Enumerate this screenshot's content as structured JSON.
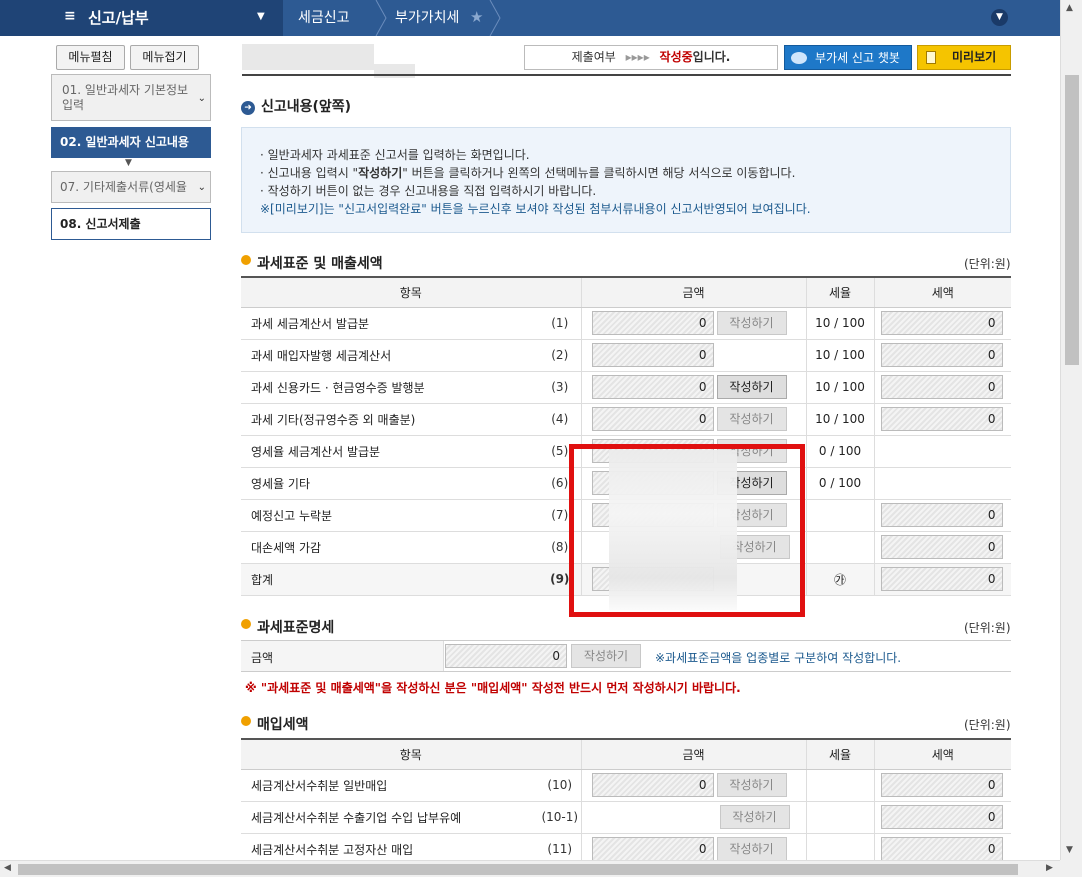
{
  "topnav": {
    "menu_title": "신고/납부",
    "crumb1": "세금신고",
    "crumb2": "부가가치세"
  },
  "sidebar": {
    "expand_label": "메뉴펼침",
    "collapse_label": "메뉴접기",
    "items": [
      {
        "label": "01. 일반과세자 기본정보입력"
      },
      {
        "label": "02. 일반과세자 신고내용"
      },
      {
        "label": "07. 기타제출서류(영세율"
      },
      {
        "label": "08. 신고서제출"
      }
    ]
  },
  "header": {
    "status_prefix": "제출여부",
    "status_arrows": "▸▸▸▸",
    "status_value": "작성중",
    "status_suffix": "입니다.",
    "chatbot_label": "부가세 신고 챗봇",
    "preview_label": "미리보기"
  },
  "section_main": {
    "title": "신고내용(앞쪽)"
  },
  "info": {
    "line1": "일반과세자 과세표준 신고서를 입력하는 화면입니다.",
    "line2_pre": "신고내용 입력시 \"",
    "line2_bold": "작성하기",
    "line2_post": "\" 버튼을 클릭하거나 왼쪽의 선택메뉴를 클릭하시면 해당 서식으로 이동합니다.",
    "line3": "작성하기 버튼이 없는 경우 신고내용을 직접 입력하시기 바랍니다.",
    "note": "※[미리보기]는 \"신고서입력완료\" 버튼을 누르신후 보셔야 작성된 첨부서류내용이 신고서반영되어 보여집니다."
  },
  "section1": {
    "title": "과세표준 및 매출세액",
    "unit": "(단위:원)",
    "headers": [
      "항목",
      "금액",
      "세율",
      "세액"
    ],
    "write_label": "작성하기",
    "rows": [
      {
        "label": "과세 세금계산서 발급분",
        "num": "(1)",
        "amount": "0",
        "rate": "10 / 100",
        "tax": "0"
      },
      {
        "label": "과세 매입자발행 세금계산서",
        "num": "(2)",
        "amount": "0",
        "rate": "10 / 100",
        "tax": "0"
      },
      {
        "label": "과세 신용카드 · 현금영수증 발행분",
        "num": "(3)",
        "amount": "0",
        "rate": "10 / 100",
        "tax": "0"
      },
      {
        "label": "과세 기타(정규영수증 외 매출분)",
        "num": "(4)",
        "amount": "0",
        "rate": "10 / 100",
        "tax": "0"
      },
      {
        "label": "영세율 세금계산서 발급분",
        "num": "(5)",
        "amount": "",
        "rate": "0 / 100",
        "tax": ""
      },
      {
        "label": "영세율 기타",
        "num": "(6)",
        "amount": "",
        "rate": "0 / 100",
        "tax": ""
      },
      {
        "label": "예정신고 누락분",
        "num": "(7)",
        "amount": "",
        "rate": "",
        "tax": "0"
      },
      {
        "label": "대손세액 가감",
        "num": "(8)",
        "amount": "",
        "rate": "",
        "tax": "0"
      },
      {
        "label": "합계",
        "num": "(9)",
        "amount": "",
        "rate": "㉮",
        "tax": "0"
      }
    ]
  },
  "section2": {
    "title": "과세표준명세",
    "unit": "(단위:원)",
    "label": "금액",
    "amount": "0",
    "write_label": "작성하기",
    "note": "※과세표준금액을 업종별로 구분하여 작성합니다.",
    "warning": "※ \"과세표준 및 매출세액\"을 작성하신 분은 \"매입세액\" 작성전 반드시 먼저 작성하시기 바랍니다."
  },
  "section3": {
    "title": "매입세액",
    "unit": "(단위:원)",
    "headers": [
      "항목",
      "금액",
      "세율",
      "세액"
    ],
    "write_label": "작성하기",
    "rows": [
      {
        "label": "세금계산서수취분 일반매입",
        "num": "(10)",
        "amount": "0",
        "tax": "0"
      },
      {
        "label": "세금계산서수취분 수출기업 수입 납부유예",
        "num": "(10-1)",
        "amount": "",
        "tax": "0"
      },
      {
        "label": "세금계산서수취분 고정자산 매입",
        "num": "(11)",
        "amount": "0",
        "tax": "0"
      }
    ]
  }
}
